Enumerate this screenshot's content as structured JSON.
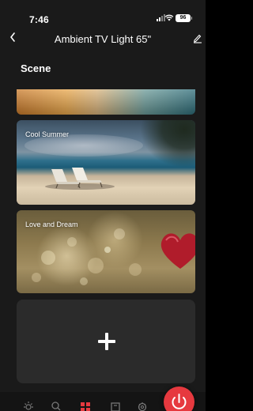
{
  "status_bar": {
    "time": "7:46",
    "battery": "96"
  },
  "nav": {
    "title": "Ambient TV Light 65\"",
    "back_icon": "chevron-left-icon",
    "edit_icon": "pencil-icon"
  },
  "section_title": "Scene",
  "scenes": [
    {
      "label": ""
    },
    {
      "label": "Cool Summer"
    },
    {
      "label": "Love and Dream"
    }
  ],
  "add_scene_icon": "plus-icon",
  "tab_bar": {
    "icons": [
      "sun-icon",
      "search-icon",
      "scene-grid-icon",
      "music-icon",
      "gear-icon"
    ],
    "active_index": 2,
    "power_icon": "power-icon"
  },
  "colors": {
    "background": "#1a1a1a",
    "card_add_bg": "#2b2b2b",
    "accent_red": "#e6393f"
  }
}
